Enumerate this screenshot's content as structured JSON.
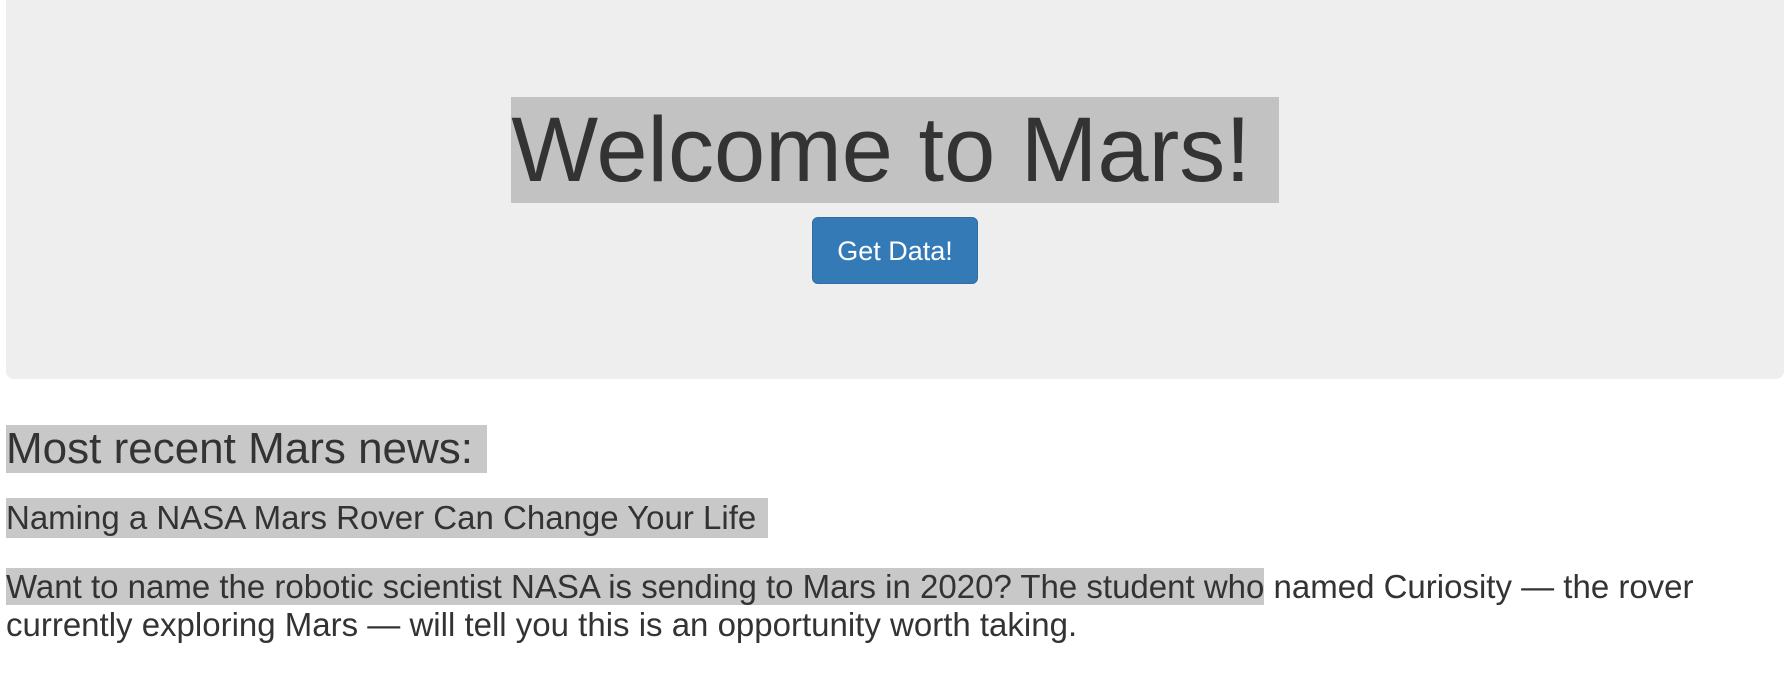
{
  "jumbotron": {
    "title": "Welcome to Mars!",
    "button_label": "Get Data!",
    "button_color": "#337ab7"
  },
  "news": {
    "heading": "Most recent Mars news:",
    "title": "Naming a NASA Mars Rover Can Change Your Life",
    "paragraph_highlighted": "Want to name the robotic scientist NASA is sending to Mars in 2020? The student who",
    "paragraph_rest": " named Curiosity — the rover currently exploring Mars — will tell you this is an opportunity worth taking."
  }
}
